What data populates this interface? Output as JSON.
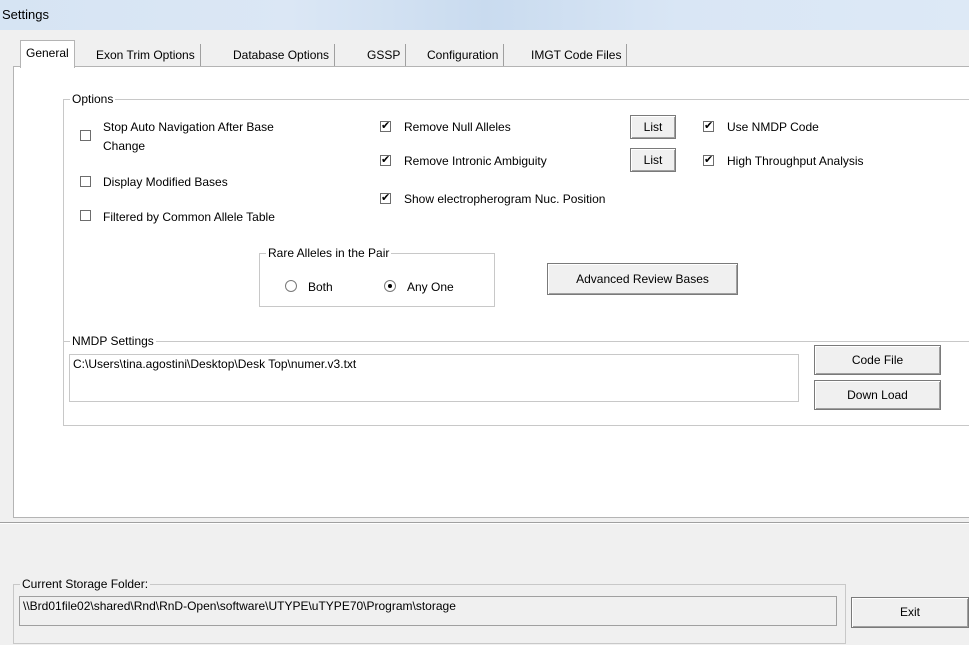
{
  "window": {
    "title": "Settings"
  },
  "tabs": [
    {
      "label": "General",
      "active": true
    },
    {
      "label": "Exon Trim Options"
    },
    {
      "label": "Database Options"
    },
    {
      "label": "GSSP"
    },
    {
      "label": "Configuration"
    },
    {
      "label": "IMGT Code Files"
    }
  ],
  "options": {
    "group_label": "Options",
    "stop_auto_nav": {
      "label_line1": "Stop Auto Navigation After Base",
      "label_line2": "Change",
      "checked": false
    },
    "display_modified": {
      "label": "Display Modified Bases",
      "checked": false
    },
    "filtered_common": {
      "label": "Filtered by Common Allele Table",
      "checked": false
    },
    "remove_null": {
      "label": "Remove Null Alleles",
      "checked": true
    },
    "remove_intronic": {
      "label": "Remove Intronic Ambiguity",
      "checked": true
    },
    "show_electro": {
      "label": "Show electropherogram Nuc. Position",
      "checked": true
    },
    "list_button_1": "List",
    "list_button_2": "List",
    "use_nmdp": {
      "label": "Use NMDP Code",
      "checked": true
    },
    "high_throughput": {
      "label": "High Throughput Analysis",
      "checked": true
    },
    "check_mark": "✔",
    "rare_alleles": {
      "group_label": "Rare Alleles in the Pair",
      "both": {
        "label": "Both",
        "selected": false
      },
      "any_one": {
        "label": "Any One",
        "selected": true
      }
    },
    "advanced_review_button": "Advanced Review Bases"
  },
  "nmdp": {
    "group_label": "NMDP Settings",
    "path": "C:\\Users\\tina.agostini\\Desktop\\Desk Top\\numer.v3.txt",
    "code_file_button": "Code File",
    "download_button": "Down Load"
  },
  "storage": {
    "group_label": "Current Storage Folder:",
    "path": "\\\\Brd01file02\\shared\\Rnd\\RnD-Open\\software\\UTYPE\\uTYPE70\\Program\\storage",
    "exit_button": "Exit"
  }
}
